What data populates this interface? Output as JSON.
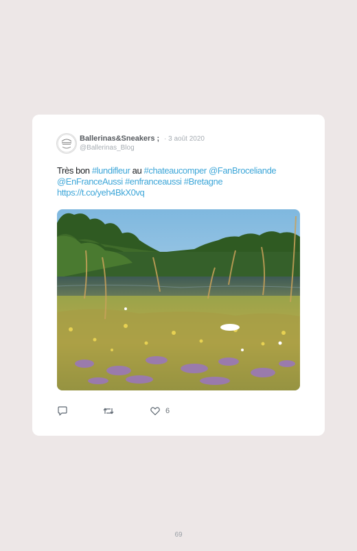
{
  "tweet": {
    "display_name": "Ballerinas&Sneakers ;",
    "date": "· 3 août 2020",
    "handle": "@Ballerinas_Blog",
    "text": {
      "t1": "Très bon ",
      "h1": "#lundifleur",
      "t2": " au ",
      "h2": "#chateaucomper",
      "t3": " ",
      "m1": "@FanBroceliande",
      "m2": "@EnFranceAussi",
      "t4": " ",
      "h3": "#enfranceaussi",
      "t5": " ",
      "h4": "#Bretagne",
      "url": "https://t.co/yeh4BkX0vq"
    },
    "like_count": "6",
    "colors": {
      "link": "#3da6d8",
      "card": "#ffffff",
      "page_background": "#ede7e7"
    },
    "icons": {
      "reply": "reply-icon",
      "retweet": "retweet-icon",
      "like": "heart-icon"
    }
  },
  "page": {
    "number": "69"
  }
}
